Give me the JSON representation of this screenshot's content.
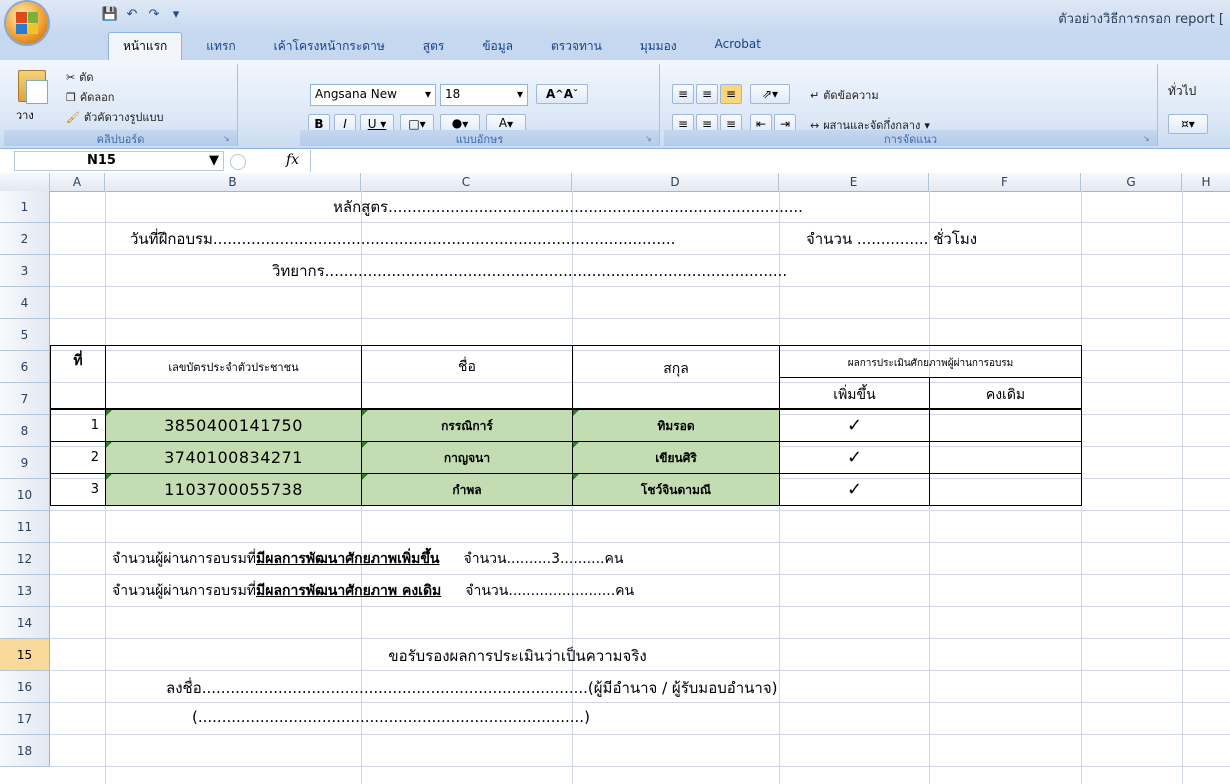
{
  "window": {
    "title": "ตัวอย่างวิธีการกรอก report  [",
    "quick_access": [
      "save-icon",
      "undo-icon",
      "redo-icon",
      "customize-icon"
    ]
  },
  "tabs": [
    "หน้าแรก",
    "แทรก",
    "เค้าโครงหน้ากระดาษ",
    "สูตร",
    "ข้อมูล",
    "ตรวจทาน",
    "มุมมอง",
    "Acrobat"
  ],
  "ribbon": {
    "clipboard": {
      "label": "คลิปบอร์ด",
      "paste": "วาง",
      "cut": "ตัด",
      "copy": "คัดลอก",
      "format_painter": "ตัวคัดวางรูปแบบ"
    },
    "font": {
      "label": "แบบอักษร",
      "font_name": "Angsana New",
      "font_size": "18"
    },
    "alignment": {
      "label": "การจัดแนว",
      "wrap_text": "ตัดข้อความ",
      "merge_center": "ผสานและจัดกึ่งกลาง"
    },
    "number": {
      "format": "ทั่วไป"
    }
  },
  "formula_bar": {
    "name_box": "N15",
    "fx": "fx",
    "value": ""
  },
  "columns": [
    "A",
    "B",
    "C",
    "D",
    "E",
    "F",
    "G",
    "H"
  ],
  "rows": [
    "1",
    "2",
    "3",
    "4",
    "5",
    "6",
    "7",
    "8",
    "9",
    "10",
    "11",
    "12",
    "13",
    "14",
    "15",
    "16",
    "17",
    "18"
  ],
  "selected_row": "15",
  "sheet": {
    "r1": "หลักสูตร.......................................................................................",
    "r2_left": "วันที่ฝึกอบรม.................................................................................................",
    "r2_right": "จำนวน ............... ชั่วโมง",
    "r3": "วิทยากร.................................................................................................",
    "hdr_no": "ที่",
    "hdr_id": "เลขบัตรประจำตัวประชาชน",
    "hdr_name": "ชื่อ",
    "hdr_surname": "สกุล",
    "hdr_eval": "ผลการประเมินศักยภาพผู้ผ่านการอบรม",
    "hdr_increase": "เพิ่มขึ้น",
    "hdr_same": "คงเดิม",
    "check": "✓",
    "table": [
      {
        "no": "1",
        "id": "3850400141750",
        "name": "กรรณิการ์",
        "surname": "ทิมรอด",
        "increase": true
      },
      {
        "no": "2",
        "id": "3740100834271",
        "name": "กาญจนา",
        "surname": "เขียนศิริ",
        "increase": true
      },
      {
        "no": "3",
        "id": "1103700055738",
        "name": "กำพล",
        "surname": "โชว์จินดามณี",
        "increase": true
      }
    ],
    "r11_a": "จำนวนผู้ผ่านการอบรมที่",
    "r11_b": "มีผลการพัฒนาศักยภาพเพิ่มขึ้น",
    "r11_c": "จำนวน..........3..........คน",
    "r12_a": "จำนวนผู้ผ่านการอบรมที่",
    "r12_b": "มีผลการพัฒนาศักยภาพ คงเดิม",
    "r12_c": "จำนวน........................คน",
    "r14": "ขอรับรองผลการประเมินว่าเป็นความจริง",
    "r15": "ลงชื่อ.................................................................................(ผู้มีอำนาจ / ผู้รับมอบอำนาจ)",
    "r16": "(.................................................................................)"
  },
  "colors": {
    "ribbon_bg": "#dbe7f6",
    "green_fill": "#c4dcb2",
    "selected_row_header": "#f9d99a"
  }
}
